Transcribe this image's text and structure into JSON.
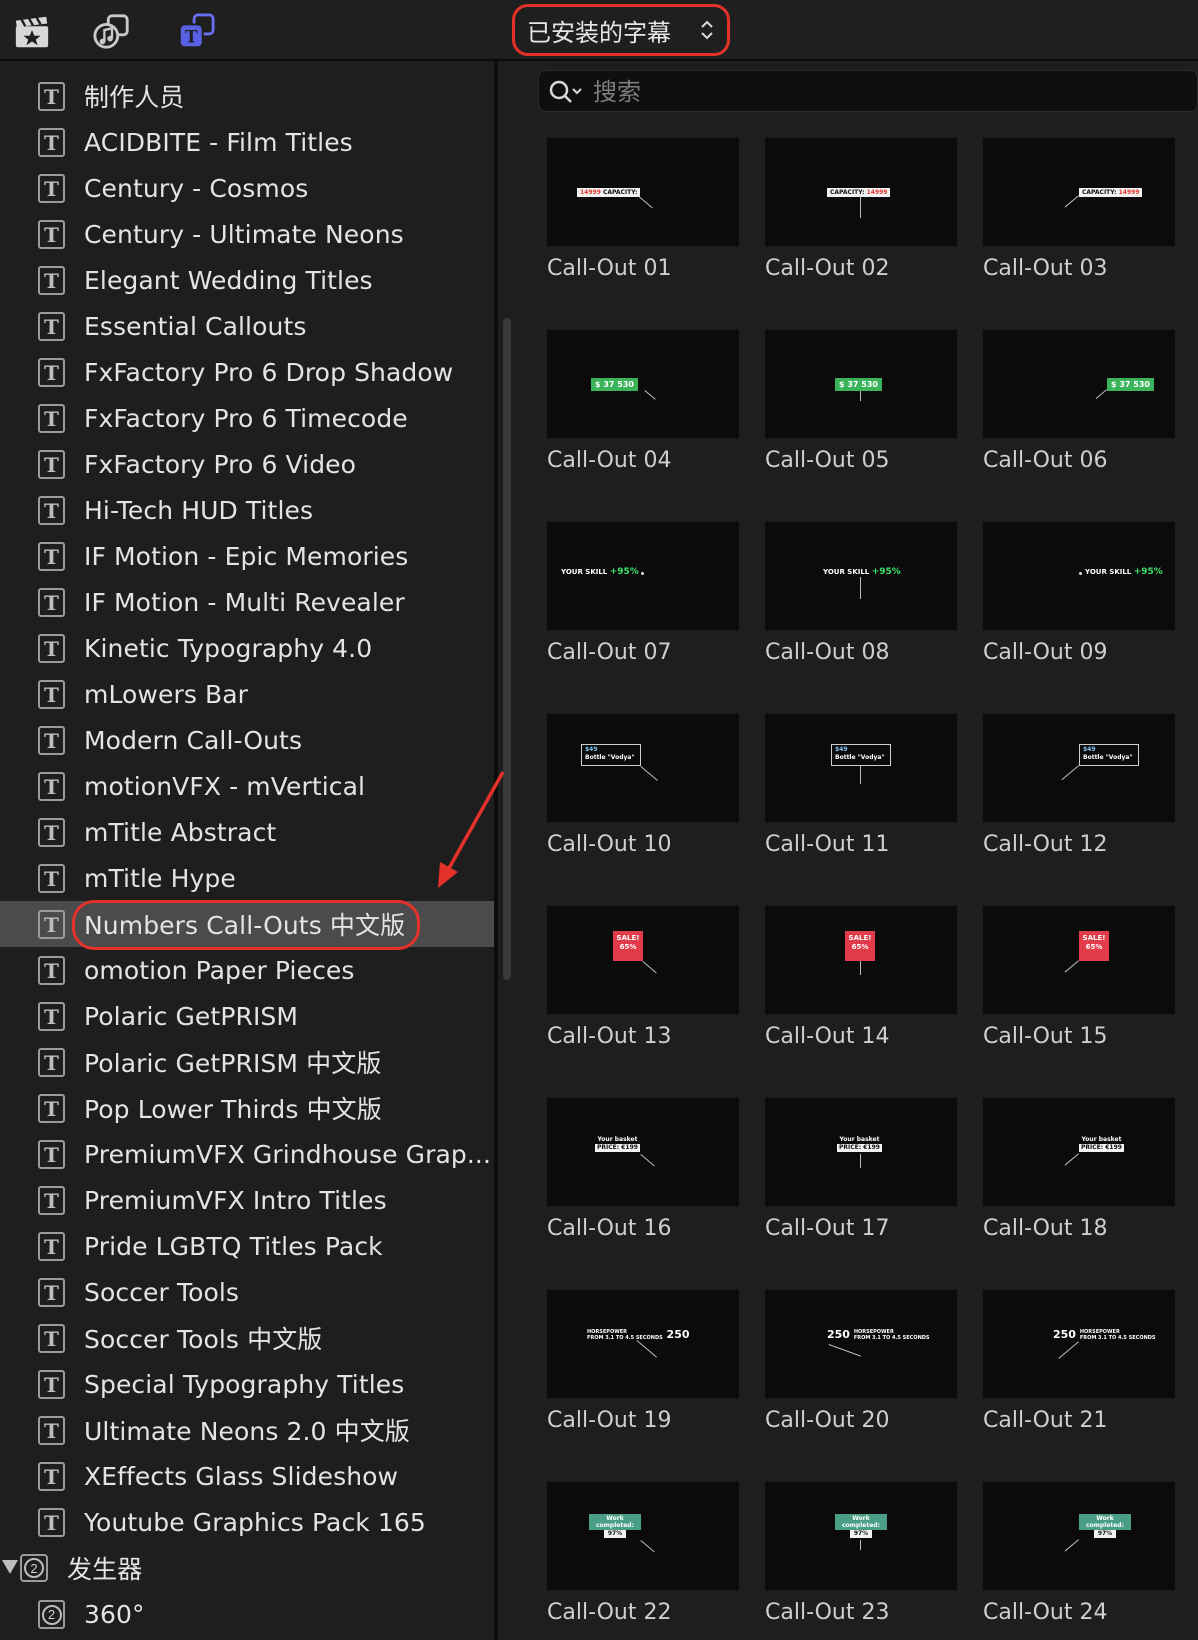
{
  "toolbar": {
    "icons": [
      "clapper-star-icon",
      "music-icon",
      "titles-generators-icon"
    ],
    "library_selector": "已安装的字幕",
    "library_selector_chevron": "chevron-updown-icon"
  },
  "search": {
    "placeholder": "搜索",
    "value": ""
  },
  "sidebar": {
    "items": [
      {
        "label": "制作人员"
      },
      {
        "label": "ACIDBITE - Film Titles"
      },
      {
        "label": "Century - Cosmos"
      },
      {
        "label": "Century - Ultimate Neons"
      },
      {
        "label": "Elegant Wedding Titles"
      },
      {
        "label": "Essential Callouts"
      },
      {
        "label": "FxFactory Pro 6 Drop Shadow"
      },
      {
        "label": "FxFactory Pro 6 Timecode"
      },
      {
        "label": "FxFactory Pro 6 Video"
      },
      {
        "label": "Hi-Tech HUD Titles"
      },
      {
        "label": "IF Motion - Epic Memories"
      },
      {
        "label": "IF Motion - Multi Revealer"
      },
      {
        "label": "Kinetic Typography 4.0"
      },
      {
        "label": "mLowers Bar"
      },
      {
        "label": "Modern Call-Outs"
      },
      {
        "label": "motionVFX - mVertical"
      },
      {
        "label": "mTitle Abstract"
      },
      {
        "label": "mTitle Hype"
      },
      {
        "label": "Numbers Call-Outs 中文版",
        "selected": true
      },
      {
        "label": "omotion Paper Pieces"
      },
      {
        "label": "Polaric GetPRISM"
      },
      {
        "label": "Polaric GetPRISM 中文版"
      },
      {
        "label": "Pop Lower Thirds 中文版"
      },
      {
        "label": "PremiumVFX Grindhouse Grap..."
      },
      {
        "label": "PremiumVFX Intro Titles"
      },
      {
        "label": "Pride LGBTQ Titles Pack"
      },
      {
        "label": "Soccer Tools"
      },
      {
        "label": "Soccer Tools 中文版"
      },
      {
        "label": "Special Typography Titles"
      },
      {
        "label": "Ultimate Neons 2.0 中文版"
      },
      {
        "label": "XEffects Glass Slideshow"
      },
      {
        "label": "Youtube Graphics Pack 165"
      }
    ],
    "group": {
      "label": "发生器",
      "icon_glyph": "2"
    },
    "group_items": [
      {
        "label": "360°",
        "icon_glyph": "2"
      }
    ]
  },
  "tiles": [
    {
      "name": "Call-Out 01",
      "kind": "capacity",
      "text_a": "14999",
      "text_b": "CAPACITY:"
    },
    {
      "name": "Call-Out 02",
      "kind": "capacity",
      "text_a": "CAPACITY:",
      "text_b": "14999"
    },
    {
      "name": "Call-Out 03",
      "kind": "capacity",
      "text_a": "CAPACITY:",
      "text_b": "14999"
    },
    {
      "name": "Call-Out 04",
      "kind": "money",
      "text_a": "$ 37 530"
    },
    {
      "name": "Call-Out 05",
      "kind": "money",
      "text_a": "$ 37 530"
    },
    {
      "name": "Call-Out 06",
      "kind": "money",
      "text_a": "$ 37 530"
    },
    {
      "name": "Call-Out 07",
      "kind": "skill",
      "text_a": "YOUR SKILL",
      "text_b": "+95%"
    },
    {
      "name": "Call-Out 08",
      "kind": "skill",
      "text_a": "YOUR SKILL",
      "text_b": "+95%"
    },
    {
      "name": "Call-Out 09",
      "kind": "skill",
      "text_a": "YOUR SKILL",
      "text_b": "+95%"
    },
    {
      "name": "Call-Out 10",
      "kind": "bottle",
      "text_a": "$49",
      "text_b": "Bottle \"Vodya\""
    },
    {
      "name": "Call-Out 11",
      "kind": "bottle",
      "text_a": "$49",
      "text_b": "Bottle \"Vodya\""
    },
    {
      "name": "Call-Out 12",
      "kind": "bottle",
      "text_a": "$49",
      "text_b": "Bottle \"Vodya\""
    },
    {
      "name": "Call-Out 13",
      "kind": "sale",
      "text_a": "SALE!",
      "text_b": "65%"
    },
    {
      "name": "Call-Out 14",
      "kind": "sale",
      "text_a": "SALE!",
      "text_b": "65%"
    },
    {
      "name": "Call-Out 15",
      "kind": "sale",
      "text_a": "SALE!",
      "text_b": "65%"
    },
    {
      "name": "Call-Out 16",
      "kind": "basket",
      "text_a": "Your basket",
      "text_b": "PRICE: €199"
    },
    {
      "name": "Call-Out 17",
      "kind": "basket",
      "text_a": "Your basket",
      "text_b": "PRICE: €199"
    },
    {
      "name": "Call-Out 18",
      "kind": "basket",
      "text_a": "Your basket",
      "text_b": "PRICE: €199"
    },
    {
      "name": "Call-Out 19",
      "kind": "hp",
      "text_a": "HORSEPOWER",
      "text_b": "250",
      "text_c": "FROM 3.1 TO 4.5 SECONDS"
    },
    {
      "name": "Call-Out 20",
      "kind": "hp",
      "text_a": "HORSEPOWER",
      "text_b": "250",
      "text_c": "FROM 3.1 TO 4.5 SECONDS"
    },
    {
      "name": "Call-Out 21",
      "kind": "hp",
      "text_a": "HORSEPOWER",
      "text_b": "250",
      "text_c": "FROM 3.1 TO 4.5 SECONDS"
    },
    {
      "name": "Call-Out 22",
      "kind": "work",
      "text_a": "Work completed:",
      "text_b": "97%"
    },
    {
      "name": "Call-Out 23",
      "kind": "work",
      "text_a": "Work completed:",
      "text_b": "97%"
    },
    {
      "name": "Call-Out 24",
      "kind": "work",
      "text_a": "Work completed:",
      "text_b": "97%"
    }
  ],
  "colors": {
    "annotation_red": "#e4322b",
    "selection_bg": "#4b4b4d",
    "panel_bg": "#1e1e1f",
    "money_green": "#3bb35a",
    "sale_red": "#e23b4a",
    "work_teal": "#4a9e86"
  }
}
